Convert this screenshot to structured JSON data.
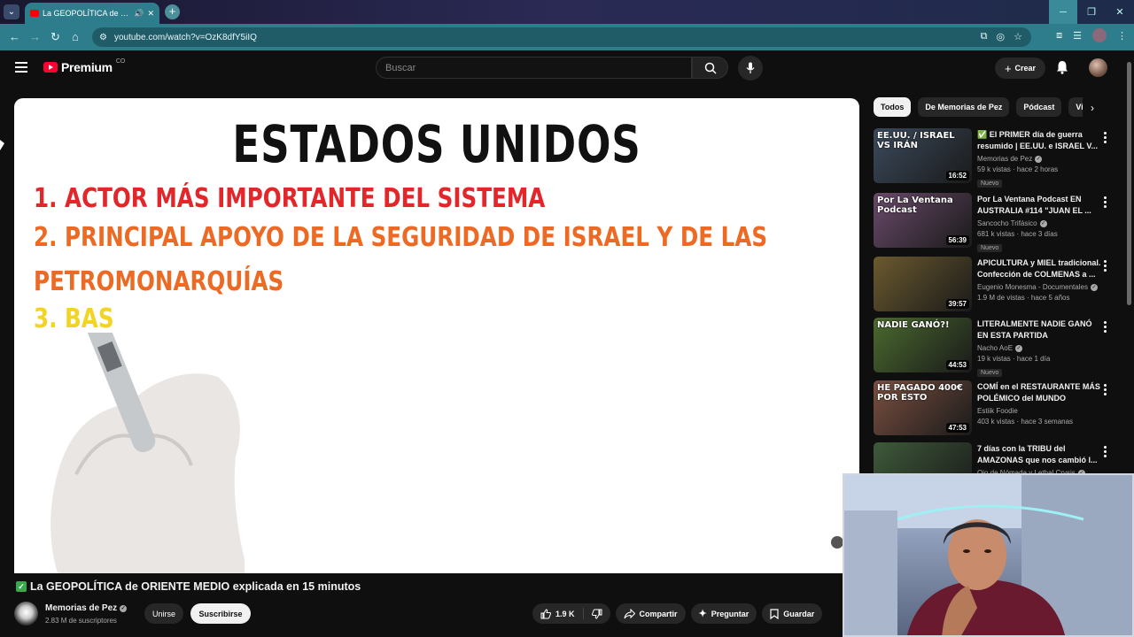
{
  "browser": {
    "tab_title": "La GEOPOLÍTICA de ORIENTE MEDIO explicada en 15 minutos",
    "url": "youtube.com/watch?v=OzK8dfY5iIQ",
    "new_tab": "+"
  },
  "header": {
    "logo_text": "Premium",
    "logo_region": "CO",
    "search_placeholder": "Buscar",
    "create_label": "Crear"
  },
  "video_frame": {
    "title": "ESTADOS UNIDOS",
    "line1": "1. ACTOR MÁS IMPORTANTE DEL SISTEMA",
    "line2a": "2. PRINCIPAL APOYO DE LA SEGURIDAD DE ISRAEL Y DE LAS",
    "line2b": "PETROMONARQUÍAS",
    "line3": "3. BAS"
  },
  "chips": [
    "Todos",
    "De Memorias de Pez",
    "Pódcast",
    "Videos"
  ],
  "recommendations": [
    {
      "title": "✅ El PRIMER día de guerra resumido | EE.UU. e ISRAEL V...",
      "channel": "Memorias de Pez",
      "verified": true,
      "meta": "59 k vistas · hace 2 horas",
      "badge": "Nuevo",
      "duration": "16:52",
      "thumb_text": "EE.UU. / ISRAEL VS IRÁN",
      "thumb_color": "#3b4a5c"
    },
    {
      "title": "Por La Ventana Podcast EN AUSTRALIA #114 \"JUAN EL ...",
      "channel": "Sancocho Trifásico",
      "verified": true,
      "meta": "681 k vistas · hace 3 días",
      "badge": "Nuevo",
      "duration": "56:39",
      "thumb_text": "Por La Ventana Podcast",
      "thumb_color": "#6a4a6a"
    },
    {
      "title": "APICULTURA y MIEL tradicional. Confección de COLMENAS a ...",
      "channel": "Eugenio Monesma - Documentales",
      "verified": true,
      "meta": "1.9 M de vistas · hace 5 años",
      "badge": "",
      "duration": "39:57",
      "thumb_text": "",
      "thumb_color": "#6b5a2e"
    },
    {
      "title": "LITERALMENTE NADIE GANÓ EN ESTA PARTIDA",
      "channel": "Nacho AoE",
      "verified": true,
      "meta": "19 k vistas · hace 1 día",
      "badge": "Nuevo",
      "duration": "44:53",
      "thumb_text": "NADIE GANÓ?!",
      "thumb_color": "#4a6a2e"
    },
    {
      "title": "COMÍ en el RESTAURANTE MÁS POLÉMICO del MUNDO",
      "channel": "Estiik Foodie",
      "verified": false,
      "meta": "403 k vistas · hace 3 semanas",
      "badge": "",
      "duration": "47:53",
      "thumb_text": "HE PAGADO 400€ POR ESTO",
      "thumb_color": "#7a5040"
    },
    {
      "title": "7 días con la TRIBU del AMAZONAS que nos cambió l...",
      "channel": "Ojo de Nómada y Lethal Crysis",
      "verified": true,
      "meta": "",
      "badge": "",
      "duration": "",
      "thumb_text": "",
      "thumb_color": "#3e5a3a"
    }
  ],
  "video": {
    "title": "La GEOPOLÍTICA de ORIENTE MEDIO explicada en 15 minutos",
    "channel": "Memorias de Pez",
    "subscribers": "2.83 M de suscriptores",
    "join_label": "Unirse",
    "subscribe_label": "Suscribirse",
    "likes": "1.9 K",
    "share_label": "Compartir",
    "ask_label": "Preguntar",
    "save_label": "Guardar"
  }
}
